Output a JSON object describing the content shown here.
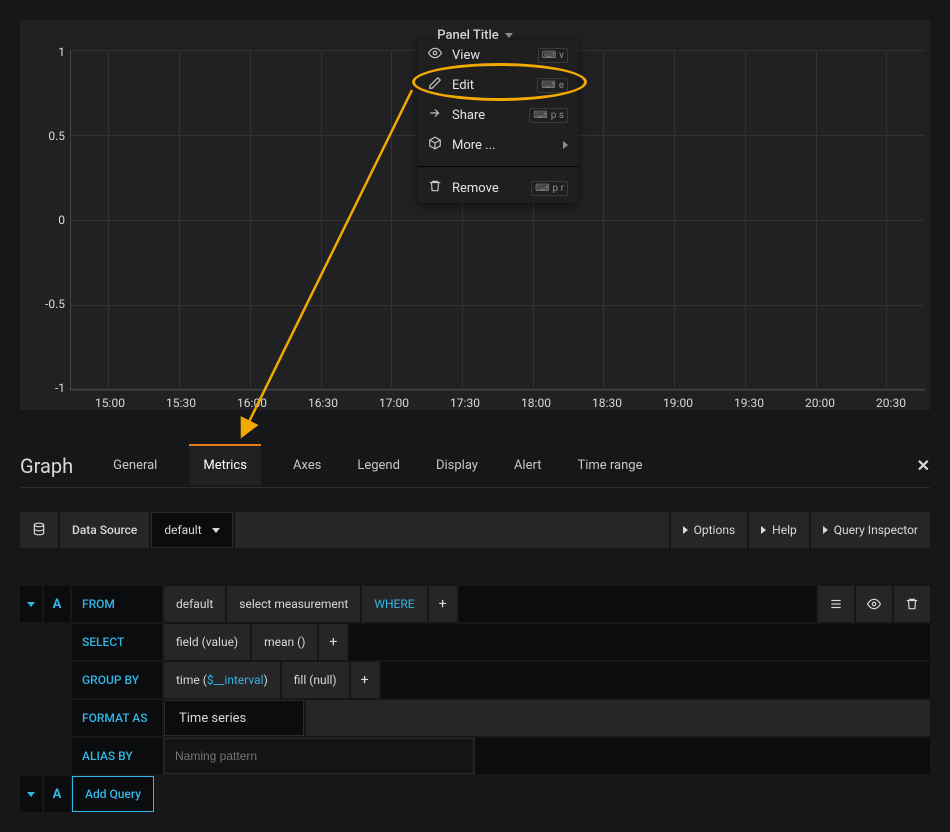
{
  "panel": {
    "title": "Panel Title"
  },
  "dropdown": {
    "view": {
      "label": "View",
      "shortcut": "v"
    },
    "edit": {
      "label": "Edit",
      "shortcut": "e"
    },
    "share": {
      "label": "Share",
      "shortcut": "p s"
    },
    "more": {
      "label": "More ..."
    },
    "remove": {
      "label": "Remove",
      "shortcut": "p r"
    }
  },
  "chart_data": {
    "type": "line",
    "series": [],
    "xlabel": "",
    "ylabel": "",
    "ylim": [
      -1.0,
      1.0
    ],
    "y_ticks": [
      1.0,
      0.5,
      0,
      -0.5,
      -1.0
    ],
    "x_ticks": [
      "15:00",
      "15:30",
      "16:00",
      "16:30",
      "17:00",
      "17:30",
      "18:00",
      "18:30",
      "19:00",
      "19:30",
      "20:00",
      "20:30"
    ]
  },
  "editor": {
    "title": "Graph",
    "tabs": {
      "general": "General",
      "metrics": "Metrics",
      "axes": "Axes",
      "legend": "Legend",
      "display": "Display",
      "alert": "Alert",
      "time_range": "Time range"
    }
  },
  "datasource": {
    "label": "Data Source",
    "selected": "default",
    "options_btn": "Options",
    "help_btn": "Help",
    "inspector_btn": "Query Inspector"
  },
  "query": {
    "letter": "A",
    "from_label": "FROM",
    "from_default": "default",
    "from_measurement": "select measurement",
    "where_label": "WHERE",
    "select_label": "SELECT",
    "select_field": "field (value)",
    "select_mean": "mean ()",
    "groupby_label": "GROUP BY",
    "groupby_time_prefix": "time (",
    "groupby_time_var": "$__interval",
    "groupby_time_suffix": ")",
    "groupby_fill": "fill (null)",
    "format_label": "FORMAT AS",
    "format_value": "Time series",
    "alias_label": "ALIAS BY",
    "alias_placeholder": "Naming pattern",
    "add_query": "Add Query"
  }
}
